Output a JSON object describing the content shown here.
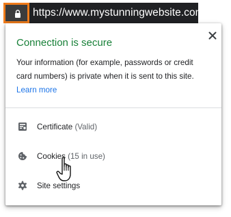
{
  "address_bar": {
    "url": "https://www.mystunningwebsite.com",
    "lock_icon": "lock-icon"
  },
  "popup": {
    "title": "Connection is secure",
    "description": "Your information (for example, passwords or credit card numbers) is private when it is sent to this site.",
    "learn_more": "Learn more",
    "close_icon": "close-icon",
    "items": [
      {
        "icon": "certificate-icon",
        "label": "Certificate",
        "sub": "(Valid)"
      },
      {
        "icon": "cookie-icon",
        "label": "Cookies",
        "sub": "(15 in use)"
      },
      {
        "icon": "gear-icon",
        "label": "Site settings",
        "sub": ""
      }
    ]
  },
  "colors": {
    "highlight_border": "#f07b1a",
    "secure_green": "#188038",
    "link_blue": "#1a73e8",
    "omnibox_bg": "#202124"
  }
}
